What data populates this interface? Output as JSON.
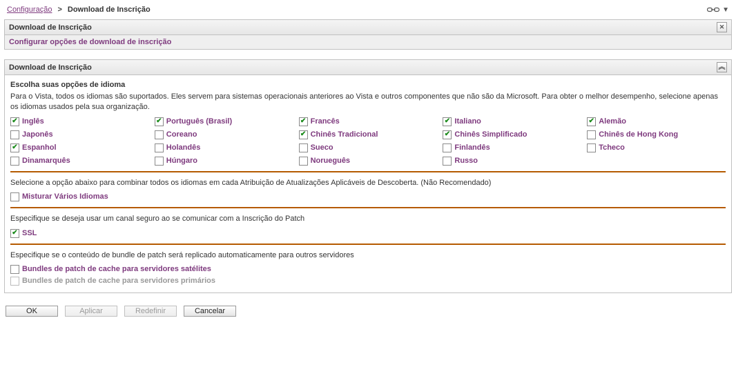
{
  "breadcrumb": {
    "parent": "Configuração",
    "current": "Download de Inscrição"
  },
  "top_panel": {
    "title": "Download de Inscrição",
    "subtitle": "Configurar opções de download de inscrição"
  },
  "main_panel": {
    "title": "Download de Inscrição",
    "lang_section": {
      "heading": "Escolha suas opções de idioma",
      "desc": "Para o Vista, todos os idiomas são suportados. Eles servem para sistemas operacionais anteriores ao Vista e outros componentes que não são da Microsoft. Para obter o melhor desempenho, selecione apenas os idiomas usados pela sua organização.",
      "languages": [
        {
          "label": "Inglês",
          "checked": true
        },
        {
          "label": "Português (Brasil)",
          "checked": true
        },
        {
          "label": "Francês",
          "checked": true
        },
        {
          "label": "Italiano",
          "checked": true
        },
        {
          "label": "Alemão",
          "checked": true
        },
        {
          "label": "Japonês",
          "checked": false
        },
        {
          "label": "Coreano",
          "checked": false
        },
        {
          "label": "Chinês Tradicional",
          "checked": true
        },
        {
          "label": "Chinês Simplificado",
          "checked": true
        },
        {
          "label": "Chinês de Hong Kong",
          "checked": false
        },
        {
          "label": "Espanhol",
          "checked": true
        },
        {
          "label": "Holandês",
          "checked": false
        },
        {
          "label": "Sueco",
          "checked": false
        },
        {
          "label": "Finlandês",
          "checked": false
        },
        {
          "label": "Tcheco",
          "checked": false
        },
        {
          "label": "Dinamarquês",
          "checked": false
        },
        {
          "label": "Húngaro",
          "checked": false
        },
        {
          "label": "Norueguês",
          "checked": false
        },
        {
          "label": "Russo",
          "checked": false
        }
      ]
    },
    "combine_section": {
      "desc": "Selecione a opção abaixo para combinar todos os idiomas em cada Atribuição de Atualizações Aplicáveis de Descoberta. (Não Recomendado)",
      "option": {
        "label": "Misturar Vários Idiomas",
        "checked": false
      }
    },
    "ssl_section": {
      "desc": "Especifique se deseja usar um canal seguro ao se comunicar com a Inscrição do Patch",
      "option": {
        "label": "SSL",
        "checked": true
      }
    },
    "bundle_section": {
      "desc": "Especifique se o conteúdo de bundle de patch será replicado automaticamente para outros servidores",
      "options": [
        {
          "label": "Bundles de patch de cache para servidores satélites",
          "checked": false,
          "disabled": false
        },
        {
          "label": "Bundles de patch de cache para servidores primários",
          "checked": false,
          "disabled": true
        }
      ]
    }
  },
  "buttons": {
    "ok": "OK",
    "apply": "Aplicar",
    "reset": "Redefinir",
    "cancel": "Cancelar"
  }
}
